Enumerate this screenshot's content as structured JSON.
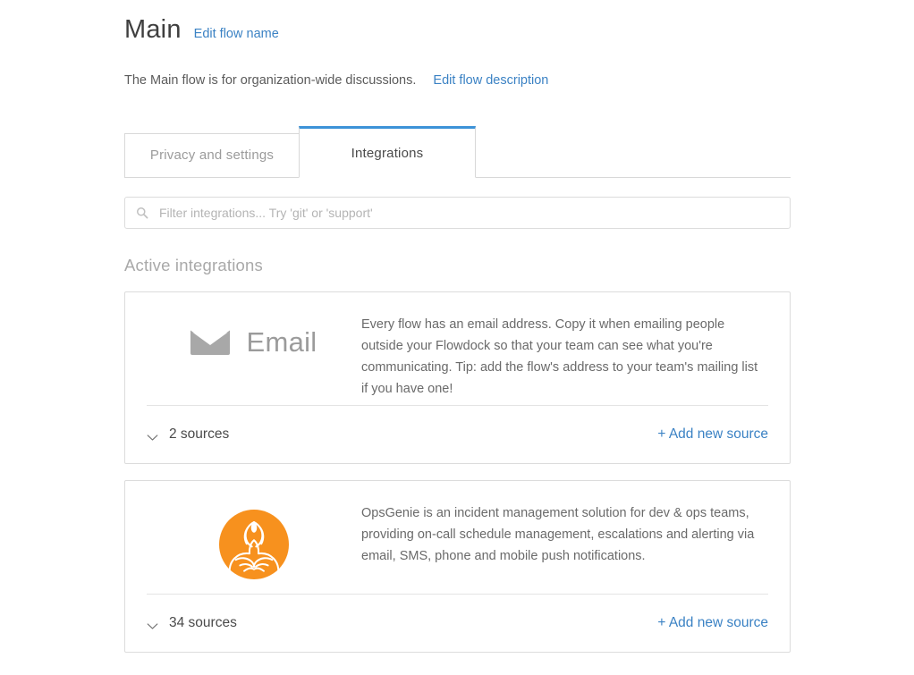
{
  "flow": {
    "title": "Main",
    "edit_name_link": "Edit flow name",
    "description": "The Main flow is for organization-wide discussions.",
    "edit_description_link": "Edit flow description"
  },
  "tabs": [
    {
      "label": "Privacy and settings",
      "active": false
    },
    {
      "label": "Integrations",
      "active": true
    }
  ],
  "search": {
    "placeholder": "Filter integrations... Try 'git' or 'support'",
    "value": "",
    "icon": "search-icon"
  },
  "sections": {
    "active_integrations_heading": "Active integrations"
  },
  "integrations": [
    {
      "name": "Email",
      "logo_type": "envelope-icon",
      "show_name_text": true,
      "description": "Every flow has an email address. Copy it when emailing people outside your Flowdock so that your team can see what you're communicating. Tip: add the flow's address to your team's mailing list if you have one!",
      "sources_label": "2 sources",
      "sources_count": 2,
      "add_source_label": "+ Add new source",
      "toggle_icon": "chevron-down-icon"
    },
    {
      "name": "OpsGenie",
      "logo_type": "opsgenie-logo",
      "show_name_text": false,
      "description": "OpsGenie is an incident management solution for dev & ops teams, providing on-call schedule management, escalations and alerting via email, SMS, phone and mobile push notifications.",
      "sources_label": "34 sources",
      "sources_count": 34,
      "add_source_label": "+ Add new source",
      "toggle_icon": "chevron-down-icon"
    }
  ],
  "colors": {
    "accent_blue": "#3d93d8",
    "link_blue": "#3b82c4",
    "opsgenie_orange": "#f7911e",
    "border_gray": "#dcdcdc",
    "text_gray": "#4a4a4a",
    "muted_gray": "#a9a9a9"
  }
}
